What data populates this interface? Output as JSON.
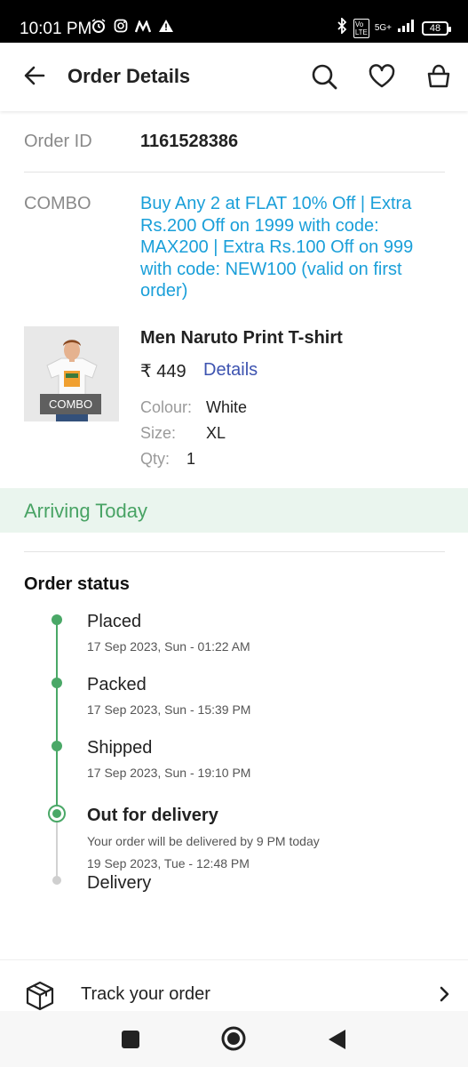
{
  "status_bar": {
    "time": "10:01 PM",
    "network_top": "5G+",
    "volte_label": "Vo LTE",
    "battery": "48",
    "icons": [
      "alarm-icon",
      "instagram-icon",
      "myntra-icon",
      "warning-icon",
      "bluetooth-icon",
      "signal-icon",
      "battery-icon"
    ]
  },
  "header": {
    "title": "Order Details",
    "icons": [
      "back-arrow-icon",
      "search-icon",
      "heart-icon",
      "bag-icon"
    ]
  },
  "order": {
    "id_label": "Order ID",
    "id_value": "1161528386",
    "combo_label": "COMBO",
    "combo_text": "Buy Any 2 at FLAT 10% Off | Extra Rs.200 Off on 1999 with code: MAX200 | Extra Rs.100 Off on 999 with code: NEW100 (valid on first order)"
  },
  "product": {
    "badge": "COMBO",
    "name": "Men Naruto Print T-shirt",
    "price": "₹ 449",
    "details_link": "Details",
    "colour_label": "Colour:",
    "colour_value": "White",
    "size_label": "Size:",
    "size_value": "XL",
    "qty_label": "Qty:",
    "qty_value": "1"
  },
  "arriving": {
    "text": "Arriving Today",
    "accent_color": "#48a364"
  },
  "order_status": {
    "title": "Order status",
    "steps": [
      {
        "title": "Placed",
        "time": "17 Sep 2023, Sun - 01:22 AM",
        "state": "done"
      },
      {
        "title": "Packed",
        "time": "17 Sep 2023, Sun - 15:39 PM",
        "state": "done"
      },
      {
        "title": "Shipped",
        "time": "17 Sep 2023, Sun - 19:10 PM",
        "state": "done"
      },
      {
        "title": "Out for delivery",
        "note": "Your order will be  delivered by 9 PM today",
        "time": "19 Sep 2023, Tue - 12:48 PM",
        "state": "current"
      },
      {
        "title": "Delivery",
        "state": "pending"
      }
    ]
  },
  "track": {
    "label": "Track your order",
    "icons": [
      "package-icon",
      "chevron-right-icon"
    ]
  },
  "nav_bar": {
    "icons": [
      "recent-apps-icon",
      "home-icon",
      "back-icon"
    ]
  }
}
